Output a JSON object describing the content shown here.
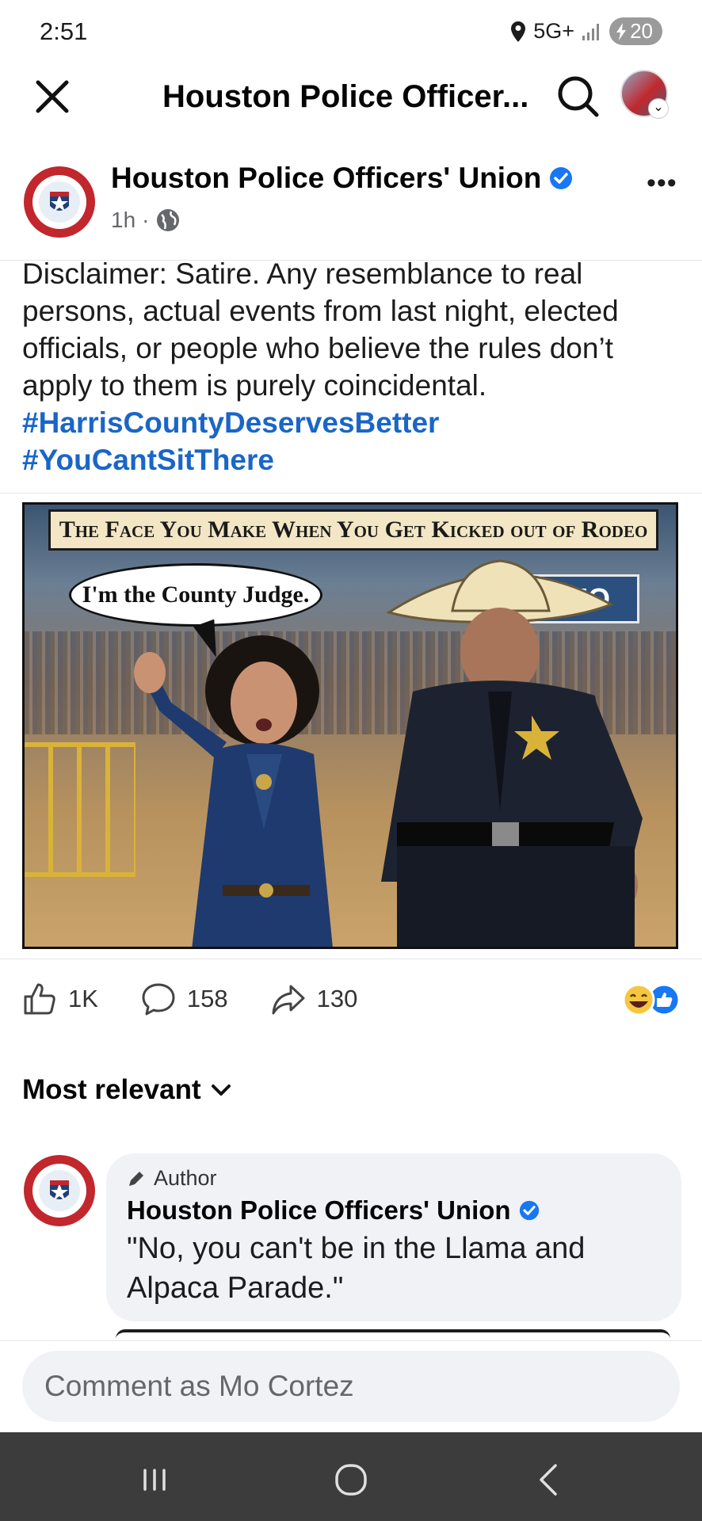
{
  "status_bar": {
    "time": "2:51",
    "network": "5G+",
    "battery": "20"
  },
  "header": {
    "title": "Houston Police Officer..."
  },
  "post": {
    "author": "Houston Police Officers' Union",
    "time": "1h",
    "separator": "·",
    "text": "Disclaimer: Satire. Any resemblance to real persons, actual events from last night, elected officials, or people who believe the rules don’t apply to them is purely coincidental.",
    "hashtags": [
      "#HarrisCountyDeservesBetter",
      "#YouCantSitThere"
    ],
    "image": {
      "banner": "The Face You Make When You Get Kicked out of Rodeo",
      "speech": "I'm the County Judge.",
      "sign": "RODEO"
    }
  },
  "engagement": {
    "likes": "1K",
    "comments": "158",
    "shares": "130"
  },
  "sort": {
    "label": "Most relevant"
  },
  "comment": {
    "badge": "Author",
    "name": "Houston Police Officers' Union",
    "text": "\"No, you can't be in the Llama and Alpaca Parade.\""
  },
  "comment_input": {
    "placeholder": "Comment as Mo Cortez"
  },
  "colors": {
    "hashtag": "#1a66c7",
    "verified": "#1877f2",
    "bubble": "#f0f2f5",
    "nav_bar": "#3c3c3c"
  }
}
